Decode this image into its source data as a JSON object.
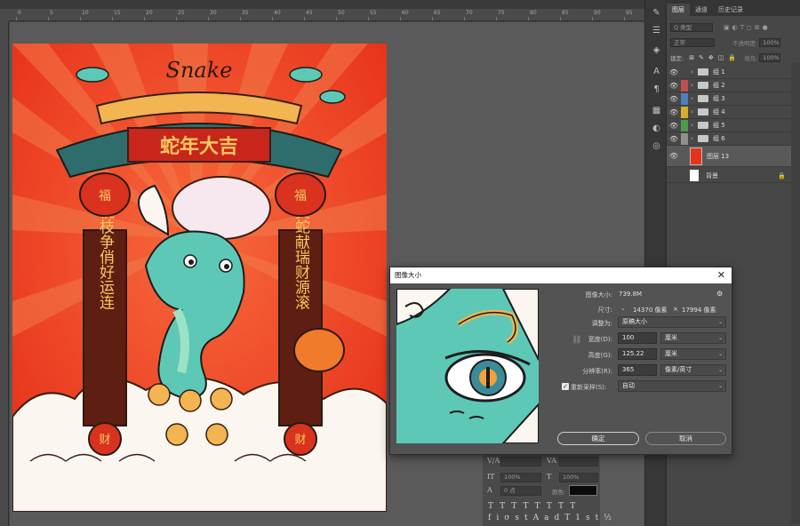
{
  "ruler": {
    "ticks": [
      "0",
      "5",
      "10",
      "15",
      "20",
      "25",
      "30",
      "35",
      "40",
      "45",
      "50",
      "55",
      "60",
      "65",
      "70",
      "75",
      "80",
      "85",
      "90",
      "95"
    ]
  },
  "panel": {
    "tabs": [
      "图层",
      "通道",
      "历史记录"
    ],
    "filter_placeholder": "Q 类型",
    "blend_mode": "正常",
    "opacity_label": "不透明度:",
    "opacity_value": "100%",
    "lock_label": "锁定:",
    "fill_label": "填充:",
    "fill_value": "100%",
    "layers": [
      {
        "name": "组 1",
        "tag_color": "#474747"
      },
      {
        "name": "组 2",
        "tag_color": "#c0504d"
      },
      {
        "name": "组 3",
        "tag_color": "#4f7fbf"
      },
      {
        "name": "组 4",
        "tag_color": "#d1b12b"
      },
      {
        "name": "组 5",
        "tag_color": "#4f9a4f"
      },
      {
        "name": "组 6",
        "tag_color": "#8f8f8f"
      }
    ],
    "selected_layer": "图层 13",
    "background_layer": "背景"
  },
  "char_panel": {
    "percent_1": "100%",
    "percent_2": "100%",
    "pt_value": "0 点",
    "color_label": "颜色:"
  },
  "dialog": {
    "title": "图像大小",
    "image_size_label": "图像大小:",
    "image_size_value": "739.8M",
    "dimensions_label": "尺寸:",
    "dimensions_w": "14370 像素",
    "dimensions_x": "×",
    "dimensions_h": "17994 像素",
    "fit_label": "调整为:",
    "fit_value": "原稿大小",
    "width_label": "宽度(D):",
    "width_value": "100",
    "width_unit": "厘米",
    "height_label": "高度(G):",
    "height_value": "125.22",
    "height_unit": "厘米",
    "resolution_label": "分辨率(R):",
    "resolution_value": "365",
    "resolution_unit": "像素/英寸",
    "resample_label": "重新采样(S):",
    "resample_value": "自动",
    "ok_label": "确定",
    "cancel_label": "取消"
  },
  "colors": {
    "artwork_red": "#ee3d1f",
    "dragon_teal": "#5ec8b6",
    "dialog_bg": "#535353"
  }
}
